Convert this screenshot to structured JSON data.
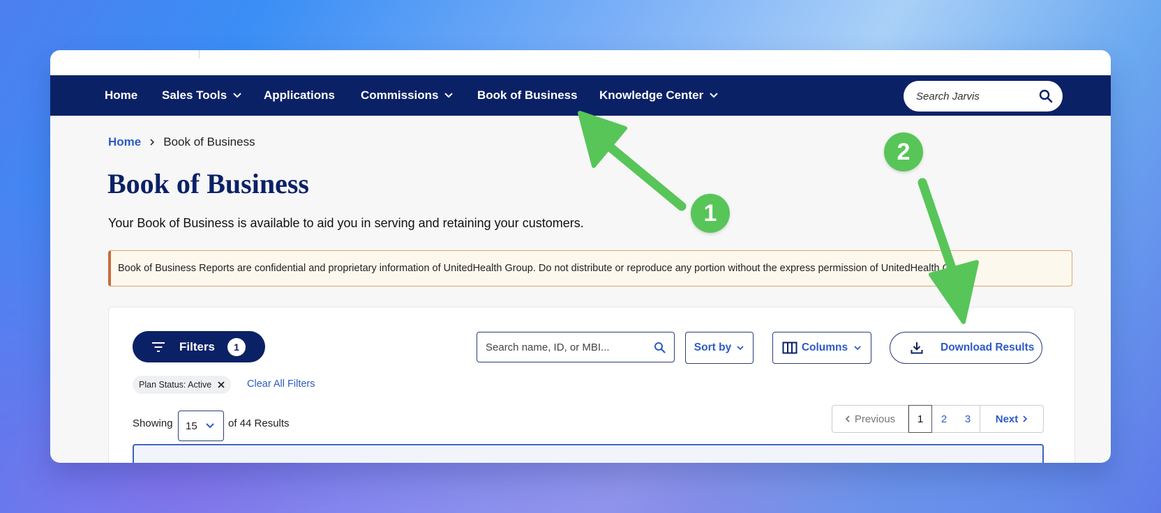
{
  "nav": {
    "items": [
      {
        "label": "Home",
        "has_dropdown": false
      },
      {
        "label": "Sales Tools",
        "has_dropdown": true
      },
      {
        "label": "Applications",
        "has_dropdown": false
      },
      {
        "label": "Commissions",
        "has_dropdown": true
      },
      {
        "label": "Book of Business",
        "has_dropdown": false
      },
      {
        "label": "Knowledge Center",
        "has_dropdown": true
      }
    ],
    "search_placeholder": "Search Jarvis"
  },
  "breadcrumb": {
    "home": "Home",
    "current": "Book of Business"
  },
  "page": {
    "title": "Book of Business",
    "subtitle": "Your Book of Business is available to aid you in serving and retaining your customers.",
    "notice": "Book of Business Reports are confidential and proprietary information of UnitedHealth Group. Do not distribute or reproduce any portion without the express permission of UnitedHealth Group."
  },
  "toolbar": {
    "filters_label": "Filters",
    "filters_count": "1",
    "search_placeholder": "Search name, ID, or MBI...",
    "sort_label": "Sort by",
    "columns_label": "Columns",
    "download_label": "Download Results"
  },
  "active_filters": {
    "chip": "Plan Status: Active",
    "clear_all": "Clear All Filters"
  },
  "results": {
    "showing_label": "Showing",
    "page_size": "15",
    "of_label": "of 44 Results"
  },
  "pagination": {
    "previous": "Previous",
    "pages": [
      "1",
      "2",
      "3"
    ],
    "current": "1",
    "next": "Next"
  },
  "annotations": [
    {
      "number": "1"
    },
    {
      "number": "2"
    }
  ],
  "colors": {
    "navy": "#0b2166",
    "link_blue": "#2c5bc5",
    "annotation_green": "#58c558",
    "notice_border": "#c96b3a"
  }
}
